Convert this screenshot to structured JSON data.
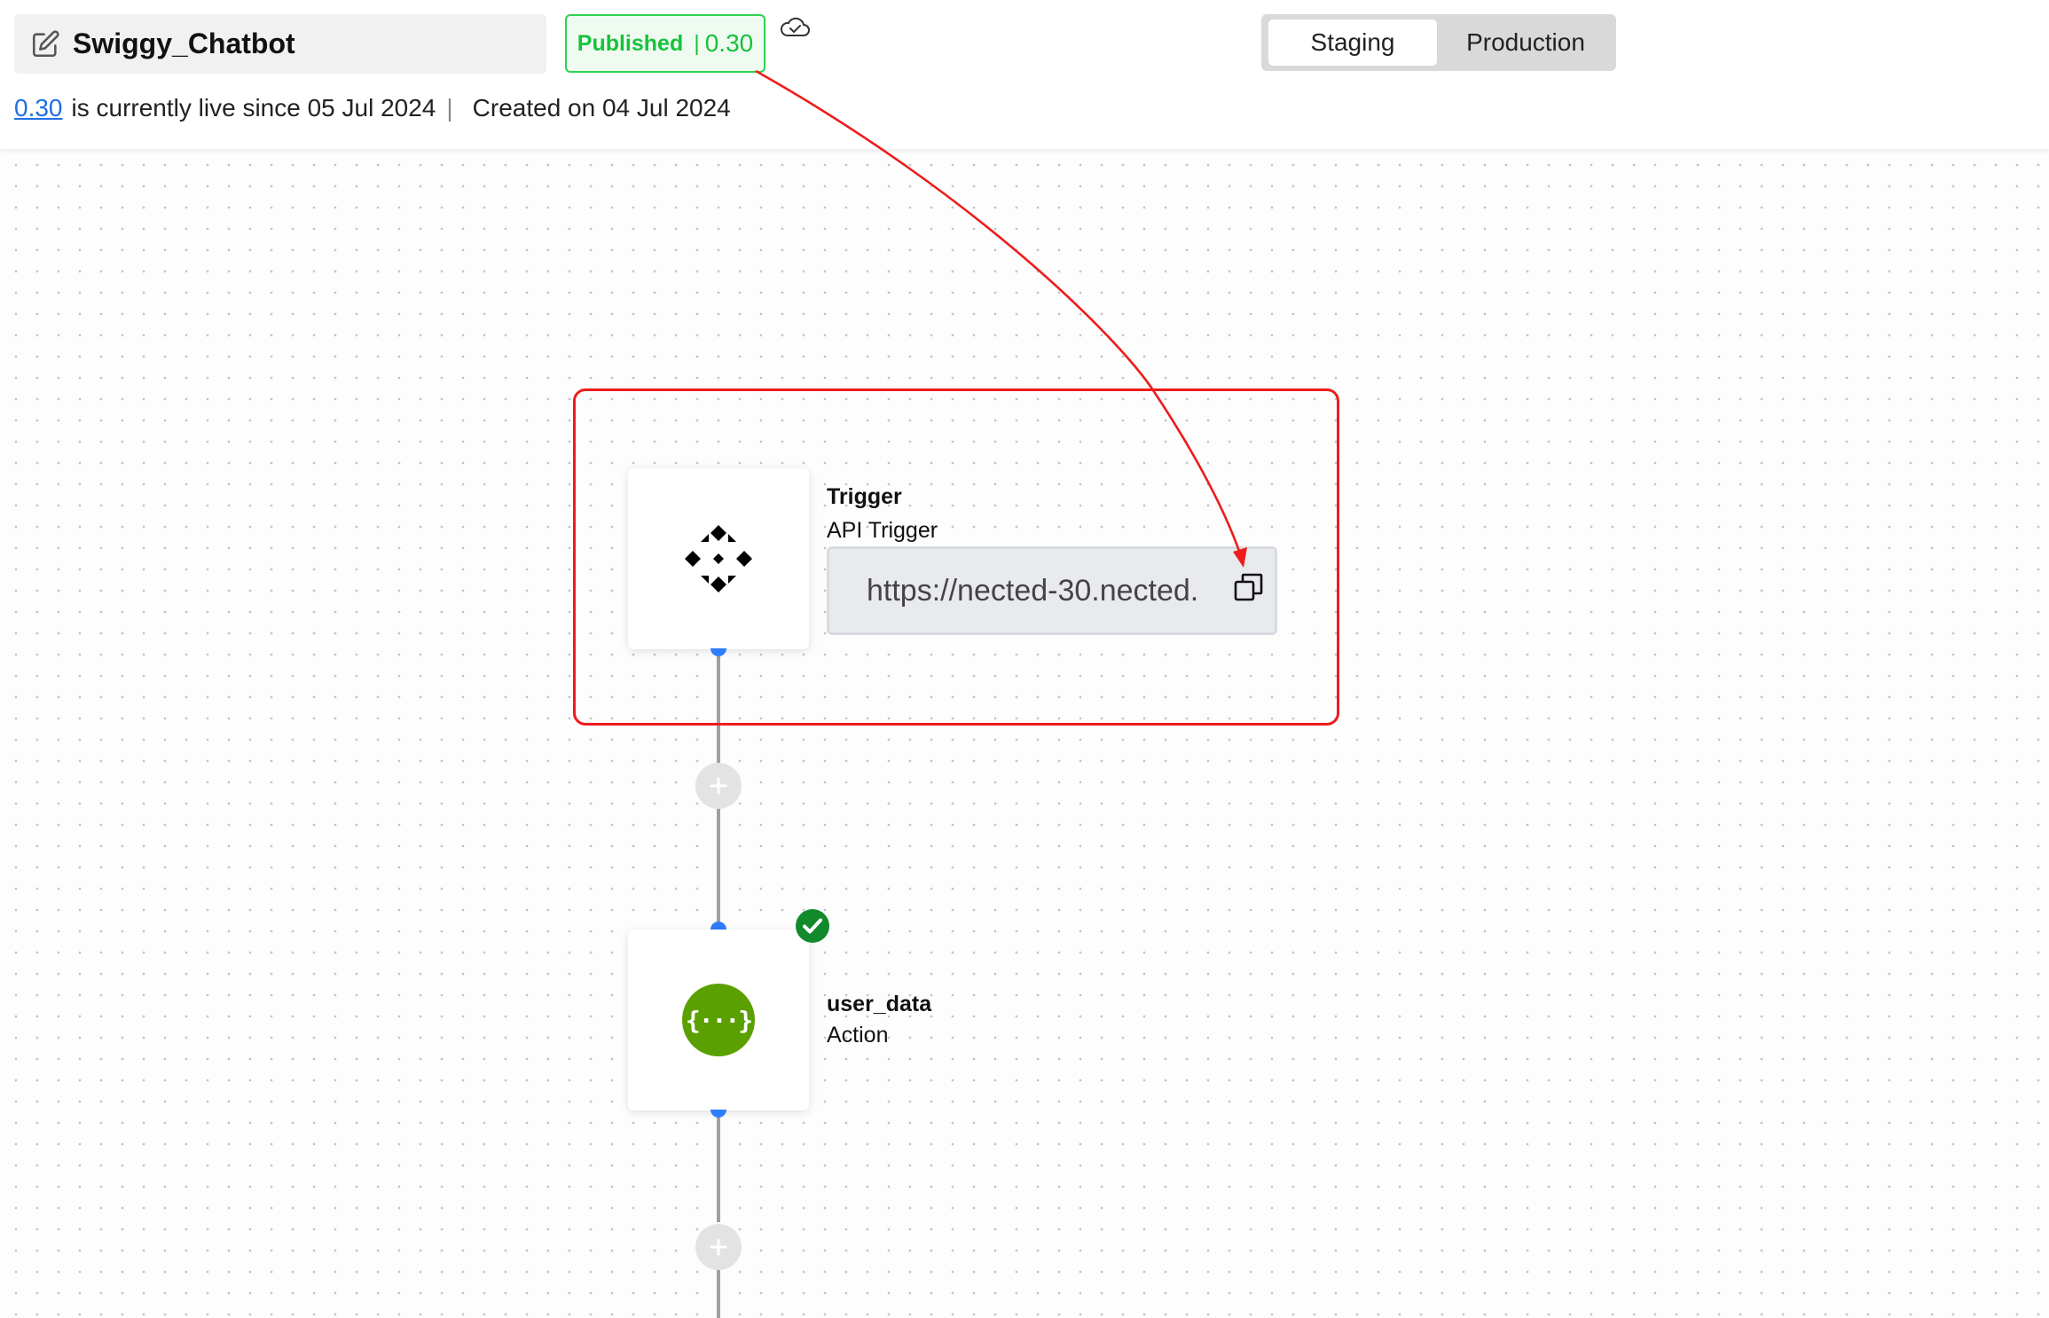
{
  "header": {
    "title": "Swiggy_Chatbot",
    "status": {
      "label": "Published",
      "separator": "|",
      "version": "0.30"
    },
    "environment_tabs": [
      "Staging",
      "Production"
    ],
    "selected_environment": "Staging",
    "live_version": "0.30",
    "live_text": "is currently live since 05 Jul 2024",
    "divider": "|",
    "created_text": "Created on 04 Jul 2024"
  },
  "flow": {
    "trigger": {
      "title": "Trigger",
      "subtitle": "API Trigger",
      "url": "https://nected-30.nected."
    },
    "action": {
      "title": "user_data",
      "subtitle": "Action",
      "icon_text": "{···}"
    }
  },
  "icons": {
    "edit": "edit-icon",
    "cloud": "cloud-check-icon",
    "trigger": "api-trigger-icon",
    "copy": "copy-icon",
    "action": "json-braces-icon",
    "add": "plus-icon",
    "status": "check-circle-icon"
  },
  "colors": {
    "published": "#17c23a",
    "link": "#1f6fe0",
    "annotation": "#ee1c1c",
    "port": "#2f7dff",
    "action_icon": "#5aa000",
    "success_badge": "#118a2c"
  }
}
